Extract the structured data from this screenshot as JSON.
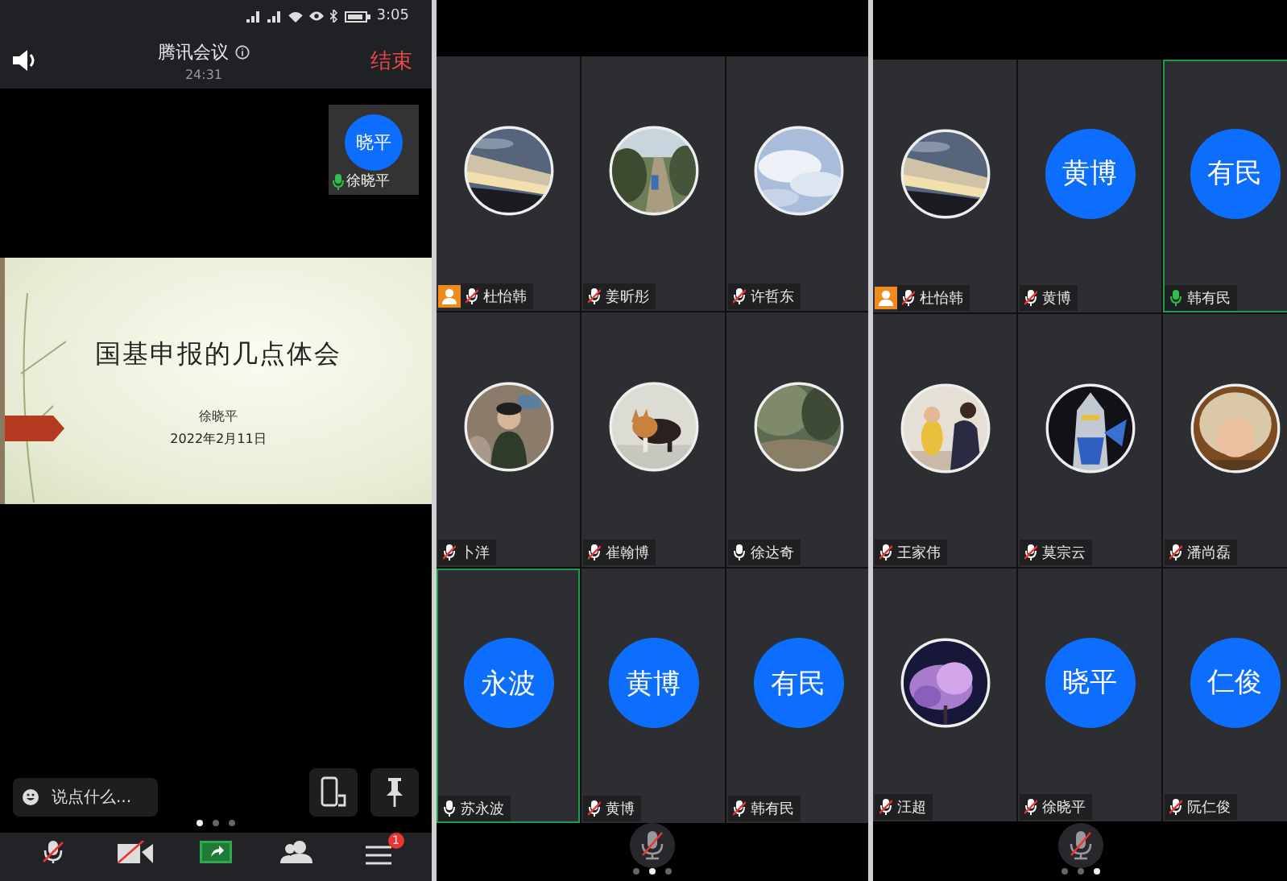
{
  "screens": [
    {
      "kind": "meeting",
      "status_bar": {
        "time": "3:05"
      },
      "header": {
        "title": "腾讯会议",
        "duration": "24:31",
        "end_button": "结束"
      },
      "self_view": {
        "initials": "晓平",
        "name": "徐晓平",
        "speaking": true
      },
      "slide": {
        "title": "国基申报的几点体会",
        "author": "徐晓平",
        "date": "2022年2月11日"
      },
      "chat": {
        "placeholder": "说点什么..."
      },
      "pages": [
        {
          "selected": true
        },
        {
          "selected": false
        },
        {
          "selected": false
        }
      ],
      "toolbar": [
        {
          "kind": "mic"
        },
        {
          "kind": "video"
        },
        {
          "kind": "share"
        },
        {
          "kind": "members"
        },
        {
          "kind": "more",
          "badge": "1"
        }
      ]
    },
    {
      "kind": "gallery",
      "mute_button": {
        "muted": true
      },
      "pages": [
        {
          "selected": false
        },
        {
          "selected": true
        },
        {
          "selected": false
        }
      ],
      "tiles": [
        {
          "name": "杜怡韩",
          "muted": true,
          "speaking": false,
          "host": true,
          "highlighted": false
        },
        {
          "name": "姜昕彤",
          "muted": true,
          "speaking": false,
          "host": false,
          "highlighted": false
        },
        {
          "name": "许哲东",
          "muted": true,
          "speaking": false,
          "host": false,
          "highlighted": false
        },
        {
          "name": "卜洋",
          "muted": true,
          "speaking": false,
          "host": false,
          "highlighted": false
        },
        {
          "name": "崔翰博",
          "muted": true,
          "speaking": false,
          "host": false,
          "highlighted": false
        },
        {
          "name": "徐达奇",
          "muted": false,
          "speaking": false,
          "host": false,
          "highlighted": false
        },
        {
          "name": "苏永波",
          "muted": false,
          "speaking": false,
          "host": false,
          "highlighted": true,
          "avatar": {
            "kind": "initials",
            "text": "永波"
          }
        },
        {
          "name": "黄博",
          "muted": true,
          "speaking": false,
          "host": false,
          "highlighted": false,
          "avatar": {
            "kind": "initials",
            "text": "黄博"
          }
        },
        {
          "name": "韩有民",
          "muted": true,
          "speaking": false,
          "host": false,
          "highlighted": false,
          "avatar": {
            "kind": "initials",
            "text": "有民"
          }
        }
      ]
    },
    {
      "kind": "gallery",
      "mute_button": {
        "muted": true
      },
      "pages": [
        {
          "selected": false
        },
        {
          "selected": false
        },
        {
          "selected": true
        }
      ],
      "tiles": [
        {
          "name": "杜怡韩",
          "muted": true,
          "speaking": false,
          "host": true,
          "highlighted": false
        },
        {
          "name": "黄博",
          "muted": true,
          "speaking": false,
          "host": false,
          "highlighted": false,
          "avatar": {
            "kind": "initials",
            "text": "黄博"
          }
        },
        {
          "name": "韩有民",
          "muted": false,
          "speaking": true,
          "host": false,
          "highlighted": true,
          "avatar": {
            "kind": "initials",
            "text": "有民"
          }
        },
        {
          "name": "王家伟",
          "muted": true,
          "speaking": false,
          "host": false,
          "highlighted": false
        },
        {
          "name": "莫宗云",
          "muted": true,
          "speaking": false,
          "host": false,
          "highlighted": false
        },
        {
          "name": "潘尚磊",
          "muted": true,
          "speaking": false,
          "host": false,
          "highlighted": false
        },
        {
          "name": "汪超",
          "muted": true,
          "speaking": false,
          "host": false,
          "highlighted": false
        },
        {
          "name": "徐晓平",
          "muted": true,
          "speaking": false,
          "host": false,
          "highlighted": false,
          "avatar": {
            "kind": "initials",
            "text": "晓平"
          }
        },
        {
          "name": "阮仁俊",
          "muted": true,
          "speaking": false,
          "host": false,
          "highlighted": false,
          "avatar": {
            "kind": "initials",
            "text": "仁俊"
          }
        }
      ]
    }
  ]
}
